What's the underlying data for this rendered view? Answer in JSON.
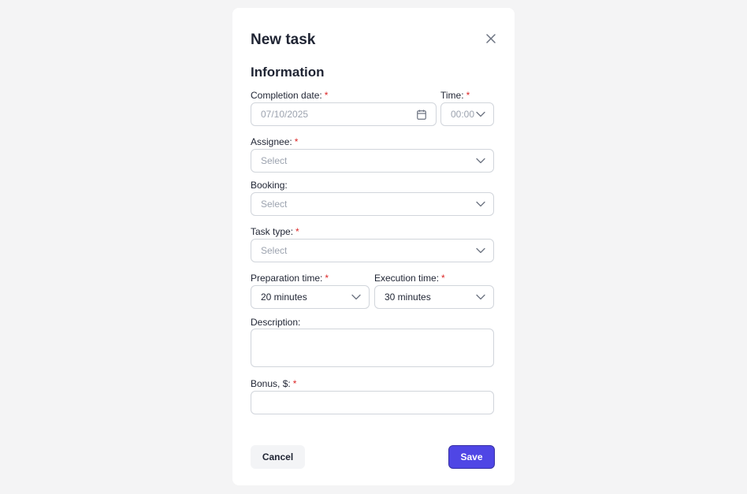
{
  "modal": {
    "title": "New task",
    "section_title": "Information"
  },
  "fields": {
    "completion_date": {
      "label": "Completion date:",
      "required": "*",
      "value": "07/10/2025"
    },
    "time": {
      "label": "Time:",
      "required": "*",
      "value": "00:00"
    },
    "assignee": {
      "label": "Assignee:",
      "required": "*",
      "placeholder": "Select"
    },
    "booking": {
      "label": "Booking:",
      "placeholder": "Select"
    },
    "task_type": {
      "label": "Task type:",
      "required": "*",
      "placeholder": "Select"
    },
    "preparation_time": {
      "label": "Preparation time:",
      "required": "*",
      "value": "20 minutes"
    },
    "execution_time": {
      "label": "Execution time:",
      "required": "*",
      "value": "30 minutes"
    },
    "description": {
      "label": "Description:",
      "value": ""
    },
    "bonus": {
      "label": "Bonus, $:",
      "required": "*",
      "value": ""
    }
  },
  "actions": {
    "cancel_label": "Cancel",
    "save_label": "Save"
  },
  "colors": {
    "accent": "#4f46e5",
    "required": "#dc2626",
    "background": "#f4f4f5"
  },
  "icons": {
    "close": "close-icon",
    "calendar": "calendar-icon",
    "dropdown": "chevron-down-icon"
  }
}
